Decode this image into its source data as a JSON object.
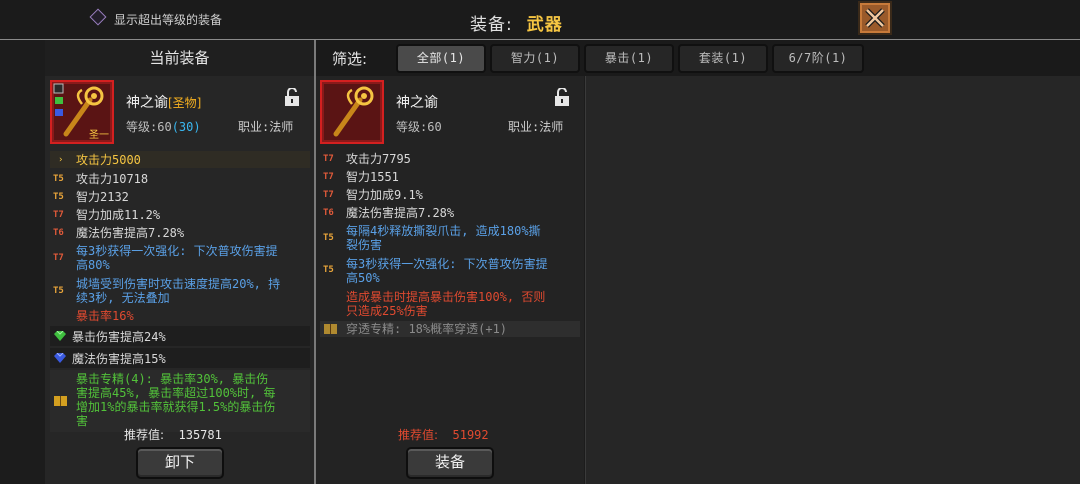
{
  "topbar": {
    "show_over_level_label": "显示超出等级的装备",
    "title_label": "装备:",
    "title_value": "武器"
  },
  "current": {
    "header": "当前装备",
    "item_name": "神之谕",
    "item_tag": "[圣物]",
    "level_label": "等级:60",
    "level_bonus": "(30)",
    "job_label": "职业:法师",
    "icon_badge": "圣一",
    "main_stat": "攻击力5000",
    "stats": [
      {
        "tier": "T5",
        "text": "攻击力10718"
      },
      {
        "tier": "T5",
        "text": "智力2132"
      },
      {
        "tier": "T7",
        "text": "智力加成11.2%"
      },
      {
        "tier": "T6",
        "text": "魔法伤害提高7.28%"
      }
    ],
    "special_1_tier": "T7",
    "special_1_line1": "每3秒获得一次强化: 下次普攻伤害提",
    "special_1_line2": "高80%",
    "special_2_tier": "T5",
    "special_2_line1": "城墙受到伤害时攻击速度提高20%, 持",
    "special_2_line2": "续3秒, 无法叠加",
    "red_line": "暴击率16%",
    "gem_1": "暴击伤害提高24%",
    "gem_2": "魔法伤害提高15%",
    "set_line1": "暴击专精(4): 暴击率30%, 暴击伤",
    "set_line2": "害提高45%, 暴击率超过100%时, 每",
    "set_line3": "增加1%的暴击率就获得1.5%的暴击伤",
    "set_line4": "害",
    "recommend_label": "推荐值:",
    "recommend_value": "135781",
    "button": "卸下"
  },
  "filter": {
    "label": "筛选:",
    "tabs": [
      "全部(1)",
      "智力(1)",
      "暴击(1)",
      "套装(1)",
      "6/7阶(1)"
    ],
    "active_index": 0
  },
  "candidate": {
    "item_name": "神之谕",
    "level_label": "等级:60",
    "job_label": "职业:法师",
    "stats": [
      {
        "tier": "T7",
        "text": "攻击力7795"
      },
      {
        "tier": "T7",
        "text": "智力1551"
      },
      {
        "tier": "T7",
        "text": "智力加成9.1%"
      },
      {
        "tier": "T6",
        "text": "魔法伤害提高7.28%"
      }
    ],
    "special_1_tier": "T5",
    "special_1_line1": "每隔4秒释放撕裂爪击, 造成180%撕",
    "special_1_line2": "裂伤害",
    "special_2_tier": "T5",
    "special_2_line1": "每3秒获得一次强化: 下次普攻伤害提",
    "special_2_line2": "高50%",
    "red_line1": "造成暴击时提高暴击伤害100%, 否则",
    "red_line2": "只造成25%伤害",
    "set_line": "穿透专精: 18%概率穿透(+1)",
    "recommend_label": "推荐值:",
    "recommend_value": "51992",
    "button": "装备"
  },
  "colors": {
    "accent_gold": "#f5c542",
    "rarity_red": "#d42020",
    "tier_orange": "#e8a43a",
    "tier_red": "#e05a3a",
    "effect_blue": "#5aa0e6",
    "set_green": "#52c23a"
  },
  "icons": {
    "close": "close-x-icon",
    "lock": "unlocked-padlock-icon",
    "gem_green": "green-gem-icon",
    "gem_blue": "blue-gem-icon",
    "set": "set-book-icon",
    "weapon": "golden-staff-icon"
  }
}
